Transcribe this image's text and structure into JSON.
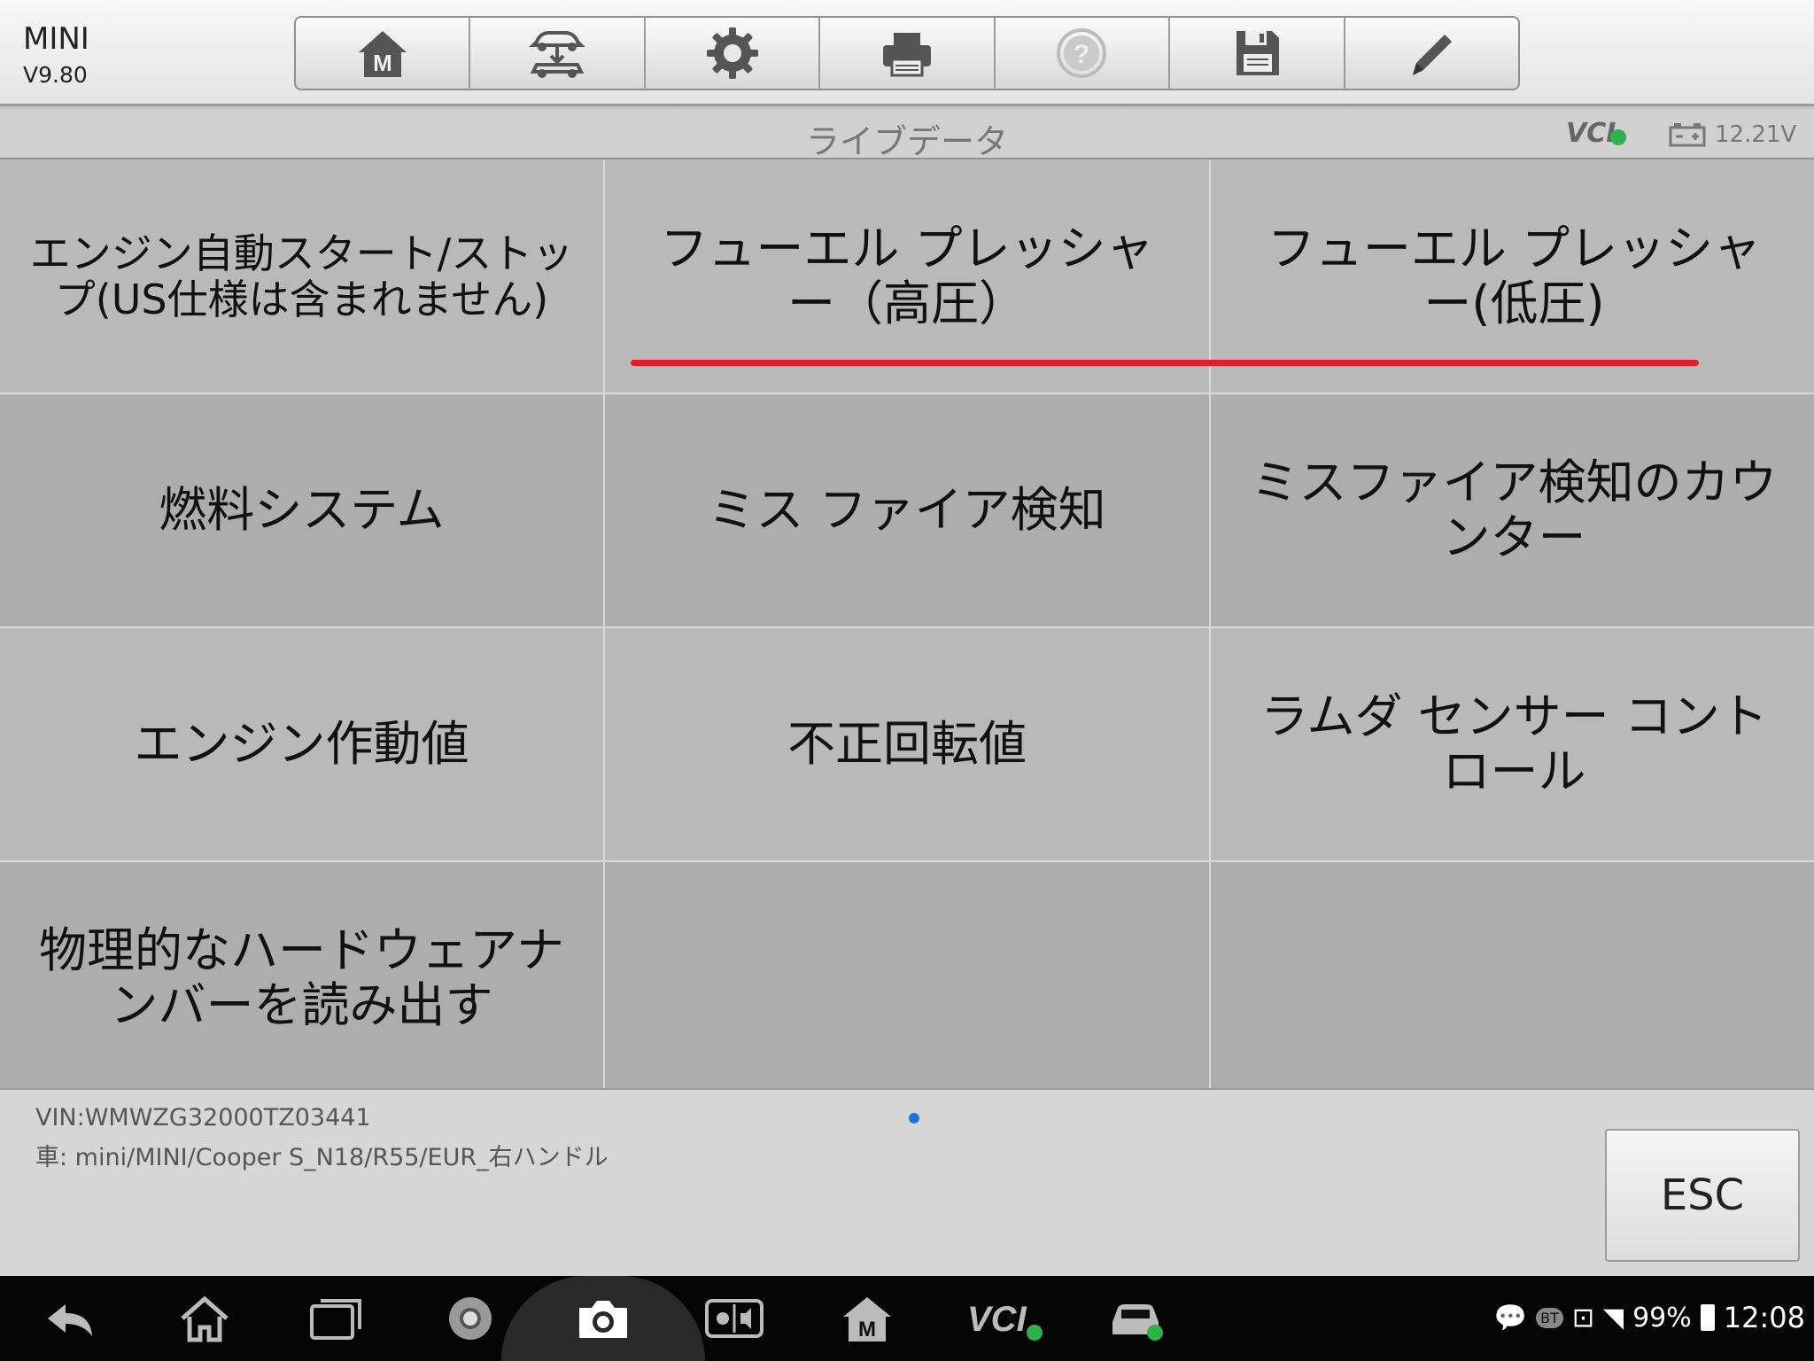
{
  "app": {
    "name": "MINI",
    "version": "V9.80"
  },
  "toolbar": {
    "buttons": [
      {
        "id": "home",
        "icon": "home-m-icon"
      },
      {
        "id": "vehicle-swap",
        "icon": "vehicle-swap-icon"
      },
      {
        "id": "settings",
        "icon": "gear-icon"
      },
      {
        "id": "print",
        "icon": "printer-icon"
      },
      {
        "id": "help",
        "icon": "help-icon"
      },
      {
        "id": "save",
        "icon": "save-icon"
      },
      {
        "id": "edit",
        "icon": "pencil-icon"
      }
    ]
  },
  "titlebar": {
    "title": "ライブデータ",
    "vci_label": "VCI",
    "voltage": "12.21V"
  },
  "grid": {
    "cells": [
      "エンジン自動スタート/ストップ(US仕様は含まれません)",
      "フューエル プレッシャー（高圧）",
      "フューエル プレッシャー(低圧)",
      "燃料システム",
      "ミス ファイア検知",
      "ミスファイア検知のカウンター",
      "エンジン作動値",
      "不正回転値",
      "ラムダ センサー コントロール",
      "物理的なハードウェアナンバーを読み出す",
      "",
      ""
    ]
  },
  "footer": {
    "vin": "VIN:WMWZG32000TZ03441",
    "car": "車: mini/MINI/Cooper S_N18/R55/EUR_右ハンドル",
    "esc_label": "ESC"
  },
  "statusbar": {
    "battery": "99%",
    "time": "12:08",
    "bt": "BT"
  },
  "navbar": {
    "vci_label": "VCI"
  },
  "colors": {
    "highlight_line": "#e31e2a",
    "check_green": "#2db34a",
    "page_dot": "#1a76d2"
  }
}
